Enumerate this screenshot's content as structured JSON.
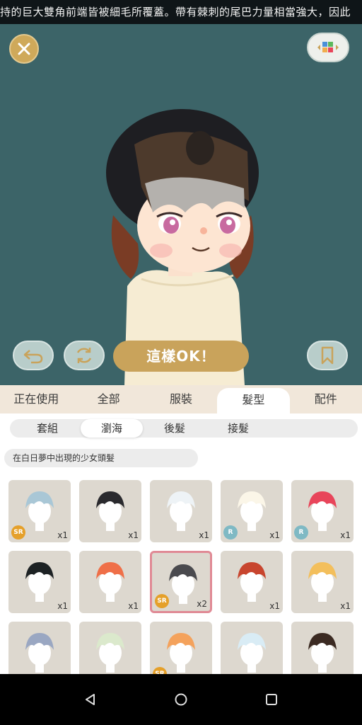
{
  "ticker": {
    "text": "持的巨大雙角前端皆被細毛所覆蓋。帶有棘刺的尾巴力量相當強大，因此"
  },
  "stage": {
    "ok_label": "這樣OK！",
    "bg_color": "#3c6468"
  },
  "tabs": [
    {
      "label": "正在使用",
      "active": false
    },
    {
      "label": "全部",
      "active": false
    },
    {
      "label": "服裝",
      "active": false
    },
    {
      "label": "髮型",
      "active": true
    },
    {
      "label": "配件",
      "active": false
    }
  ],
  "subtabs": [
    {
      "label": "套組",
      "active": false
    },
    {
      "label": "瀏海",
      "active": true
    },
    {
      "label": "後髮",
      "active": false
    },
    {
      "label": "接髮",
      "active": false
    }
  ],
  "description": "在白日夢中出現的少女頭髮",
  "items": [
    {
      "color": "#a9c7d6",
      "rarity": "SR",
      "count": "x1"
    },
    {
      "color": "#2a2a2e",
      "rarity": "",
      "count": "x1"
    },
    {
      "color": "#eef3f6",
      "rarity": "",
      "count": "x1"
    },
    {
      "color": "#fbf6e8",
      "rarity": "R",
      "count": "x1"
    },
    {
      "color": "#e8455a",
      "rarity": "R",
      "count": "x1"
    },
    {
      "color": "#1d2224",
      "rarity": "",
      "count": "x1"
    },
    {
      "color": "#ef6f48",
      "rarity": "",
      "count": "x1"
    },
    {
      "color": "#4a4a4e",
      "rarity": "SR",
      "count": "x2",
      "selected": true
    },
    {
      "color": "#c8452e",
      "rarity": "",
      "count": "x1"
    },
    {
      "color": "#f3bf5c",
      "rarity": "",
      "count": "x1"
    },
    {
      "color": "#9aa7c2",
      "rarity": "",
      "count": ""
    },
    {
      "color": "#dbe9cc",
      "rarity": "",
      "count": ""
    },
    {
      "color": "#f4a25c",
      "rarity": "SR",
      "count": ""
    },
    {
      "color": "#d9ecf5",
      "rarity": "",
      "count": ""
    },
    {
      "color": "#3b2a22",
      "rarity": "",
      "count": ""
    }
  ]
}
